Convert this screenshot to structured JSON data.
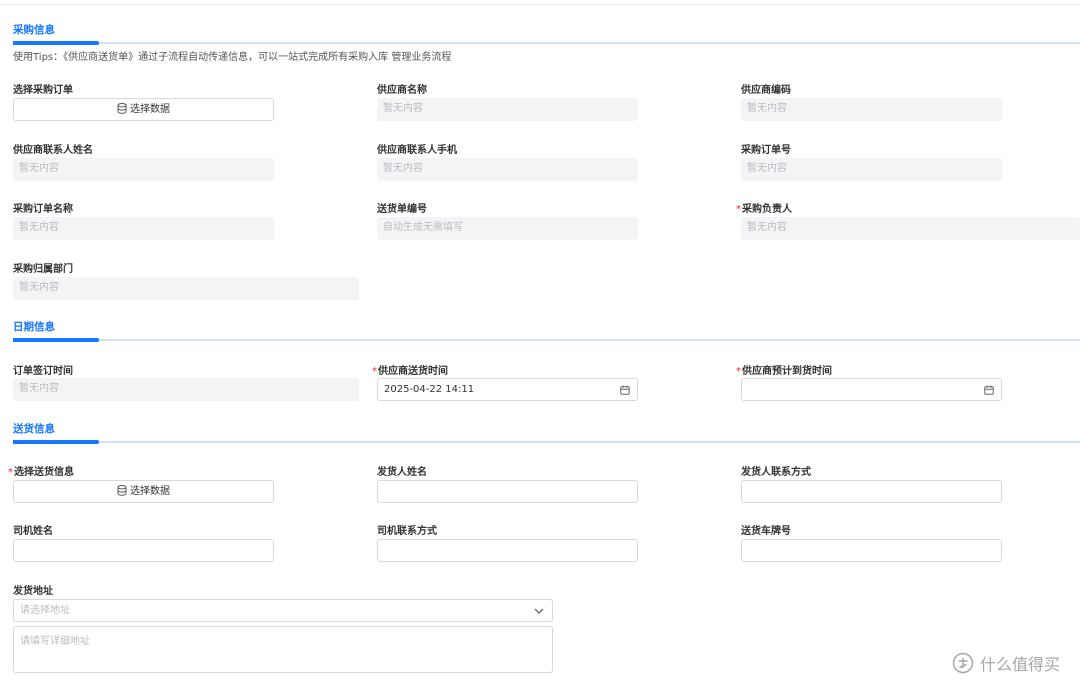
{
  "sections": {
    "purchase": "采购信息",
    "date": "日期信息",
    "delivery": "送货信息"
  },
  "tips": "使用Tips：《供应商送货单》通过子流程自动传递信息，可以一站式完成所有采购入库 管理业务流程",
  "common": {
    "empty": "暂无内容",
    "select_data": "选择数据"
  },
  "purchase": {
    "select_order_label": "选择采购订单",
    "supplier_name_label": "供应商名称",
    "supplier_code_label": "供应商编码",
    "contact_name_label": "供应商联系人姓名",
    "contact_phone_label": "供应商联系人手机",
    "order_no_label": "采购订单号",
    "order_name_label": "采购订单名称",
    "delivery_no_label": "送货单编号",
    "delivery_no_value": "自动生成无需填写",
    "owner_label": "采购负责人",
    "department_label": "采购归属部门"
  },
  "date": {
    "sign_time_label": "订单签订时间",
    "supplier_delivery_time_label": "供应商送货时间",
    "supplier_delivery_time_value": "2025-04-22 14:11",
    "expected_arrival_label": "供应商预计到货时间",
    "expected_arrival_value": ""
  },
  "delivery": {
    "select_info_label": "选择送货信息",
    "shipper_name_label": "发货人姓名",
    "shipper_contact_label": "发货人联系方式",
    "driver_name_label": "司机姓名",
    "driver_contact_label": "司机联系方式",
    "plate_label": "送货车牌号",
    "address_label": "发货地址",
    "address_placeholder": "请选择地址",
    "detail_placeholder": "请填写详细地址"
  },
  "required_mark": "*",
  "watermark": "什么值得买",
  "colors": {
    "accent": "#1677ff",
    "required": "#f5222d",
    "disabled_bg": "#f3f4f6"
  }
}
